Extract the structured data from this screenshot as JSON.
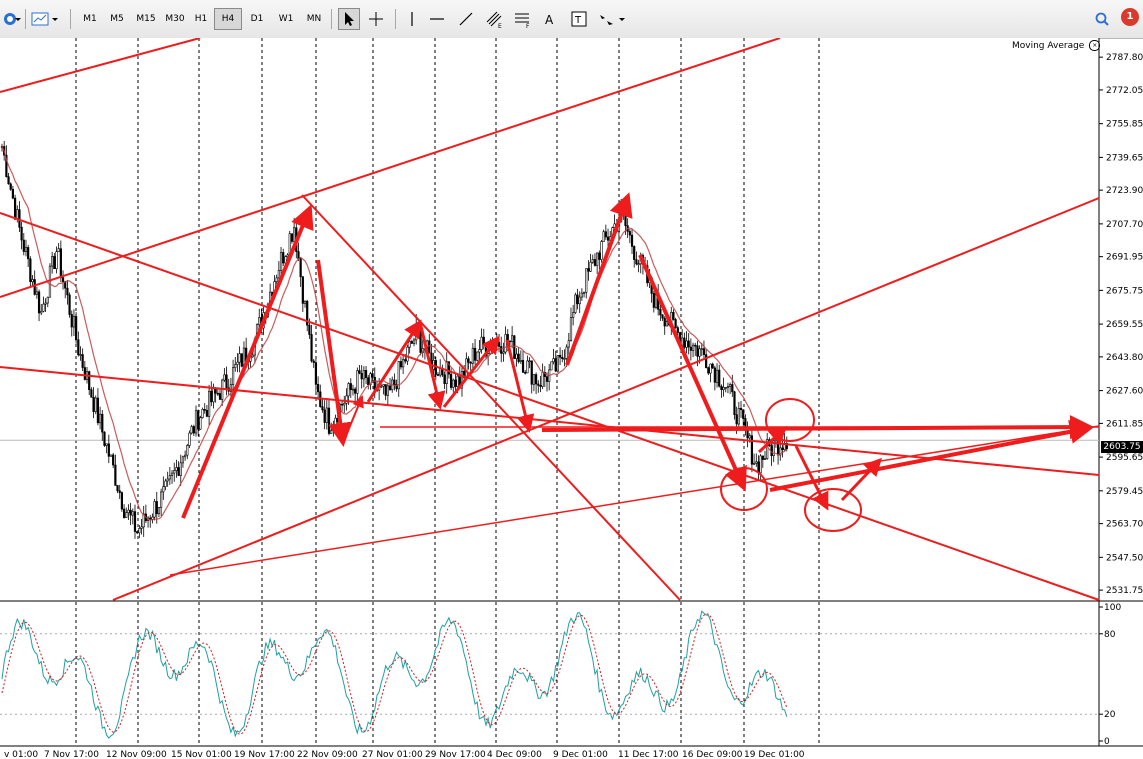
{
  "toolbar": {
    "timeframes": [
      "M1",
      "M5",
      "M15",
      "M30",
      "H1",
      "H4",
      "D1",
      "W1",
      "MN"
    ],
    "active_timeframe": "H4",
    "tool_icons": [
      "cursor-icon",
      "crosshair-icon",
      "vertical-line-icon",
      "horizontal-line-icon",
      "trendline-icon",
      "channel-icon",
      "fibonacci-icon",
      "text-icon",
      "text-label-icon",
      "arrow-shapes-icon"
    ],
    "notification_count": "1"
  },
  "chart": {
    "indicator_name": "Moving Average",
    "current_price": "2603.75",
    "price_scale": [
      "2787.80",
      "2772.05",
      "2755.85",
      "2739.65",
      "2723.90",
      "2707.70",
      "2691.95",
      "2675.75",
      "2659.55",
      "2643.80",
      "2627.60",
      "2611.85",
      "2595.65",
      "2579.45",
      "2563.70",
      "2547.50",
      "2531.75"
    ],
    "oscillator_scale": [
      "100",
      "80",
      "20",
      "0"
    ],
    "time_labels": [
      "v 01:00",
      "7 Nov 17:00",
      "12 Nov 09:00",
      "15 Nov 01:00",
      "19 Nov 17:00",
      "22 Nov 09:00",
      "27 Nov 01:00",
      "29 Nov 17:00",
      "4 Dec 09:00",
      "9 Dec 01:00",
      "11 Dec 17:00",
      "16 Dec 09:00",
      "19 Dec 01:00"
    ]
  },
  "colors": {
    "bullish_candle": "#ffffff",
    "bearish_candle": "#000000",
    "drawings": "#ee1c1c",
    "moving_average": "#c04040",
    "stochastic_main": "#20a0a0",
    "stochastic_signal": "#d02020"
  }
}
